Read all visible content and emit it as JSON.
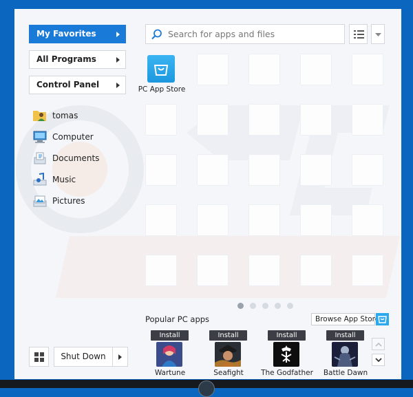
{
  "nav": {
    "favorites": "My Favorites",
    "all_programs": "All Programs",
    "control_panel": "Control Panel"
  },
  "places": [
    {
      "label": "tomas",
      "icon": "user-folder-icon"
    },
    {
      "label": "Computer",
      "icon": "computer-icon"
    },
    {
      "label": "Documents",
      "icon": "documents-icon"
    },
    {
      "label": "Music",
      "icon": "music-icon"
    },
    {
      "label": "Pictures",
      "icon": "pictures-icon"
    }
  ],
  "search": {
    "placeholder": "Search for apps and files"
  },
  "app_store": {
    "label": "PC App Store"
  },
  "pager": {
    "pages": 5,
    "active": 1
  },
  "popular": {
    "title": "Popular PC apps",
    "browse_label": "Browse App Store",
    "install_label": "Install",
    "apps": [
      {
        "name": "Wartune"
      },
      {
        "name": "Seafight"
      },
      {
        "name": "The Godfather"
      },
      {
        "name": "Battle Dawn"
      }
    ]
  },
  "footer": {
    "shutdown_label": "Shut Down"
  },
  "colors": {
    "accent": "#1a7ad8",
    "frame": "#0a66bf"
  }
}
